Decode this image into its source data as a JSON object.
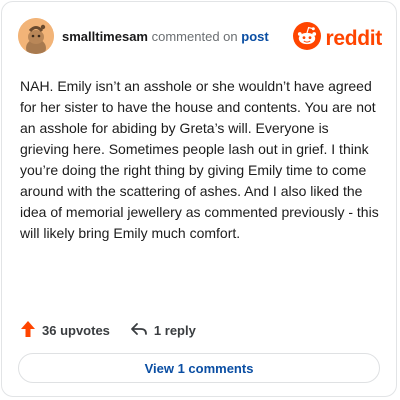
{
  "author": {
    "username": "smalltimesam",
    "action_text": "commented on",
    "target_text": "post",
    "avatar_icon": "snoo-avatar-icon"
  },
  "brand": {
    "name": "reddit",
    "logo_icon": "reddit-snoo-logo-icon",
    "color": "#ff4500"
  },
  "comment": {
    "text": "NAH. Emily isn’t an asshole or she wouldn’t have agreed for her sister to have the house and contents. You are not an asshole for abiding by Greta’s will. Everyone is grieving here. Sometimes people lash out in grief. I think you’re doing the right thing by giving Emily time to come around with the scattering of ashes. And I also liked the idea of memorial jewellery as commented previously - this will likely bring Emily much comfort."
  },
  "actions": {
    "upvotes_label": "36 upvotes",
    "upvote_icon": "upvote-arrow-icon",
    "upvote_color": "#ff4500",
    "reply_label": "1 reply",
    "reply_icon": "reply-arrow-icon"
  },
  "footer": {
    "view_comments_label": "View 1 comments",
    "link_color": "#0a4ea3"
  }
}
